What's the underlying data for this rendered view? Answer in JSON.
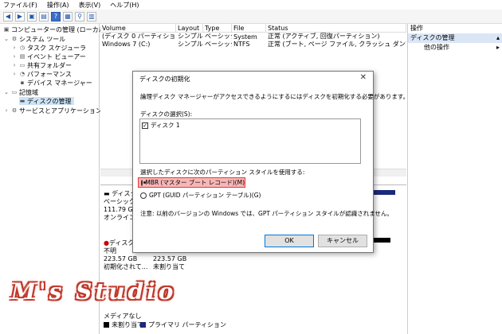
{
  "menu": [
    "ファイル(F)",
    "操作(A)",
    "表示(V)",
    "ヘルプ(H)"
  ],
  "tree": {
    "root": "コンピューターの管理 (ローカル)",
    "system_tools": "システム ツール",
    "task_scheduler": "タスク スケジューラ",
    "event_viewer": "イベント ビューアー",
    "shared_folders": "共有フォルダー",
    "performance": "パフォーマンス",
    "device_manager": "デバイス マネージャー",
    "storage": "記憶域",
    "disk_management": "ディスクの管理",
    "services_apps": "サービスとアプリケーション"
  },
  "volume_list": {
    "headers": [
      "Volume",
      "Layout",
      "Type",
      "File System",
      "Status"
    ],
    "rows": [
      [
        "(ディスク 0 パーティション 1)",
        "シンプル",
        "ベーシック",
        "",
        "正常 (アクティブ, 回復パーティション)"
      ],
      [
        "Windows 7 (C:)",
        "シンプル",
        "ベーシック",
        "NTFS",
        "正常 (ブート, ページ ファイル, クラッシュ ダンプ, プライマリ パ"
      ]
    ]
  },
  "disks": {
    "disk0": {
      "label": "ディスク",
      "type": "ベーシック",
      "size": "111.79 GB",
      "status": "オンライン"
    },
    "disk1": {
      "label": "ディスク",
      "type": "不明",
      "size": "223.57 GB",
      "status": "初期化されて...",
      "part_size": "223.57 GB",
      "part_status": "未割り当て"
    }
  },
  "legend": {
    "media": "メディアなし",
    "unallocated": "未割り当て",
    "primary": "プライマリ パーティション"
  },
  "actions": {
    "title": "操作",
    "section": "ディスクの管理",
    "other": "他の操作"
  },
  "dialog": {
    "title": "ディスクの初期化",
    "description": "論理ディスク マネージャーがアクセスできるようにするにはディスクを初期化する必要があります。",
    "select_label": "ディスクの選択(S):",
    "disk_item": "ディスク 1",
    "style_label": "選択したディスクに次のパーティション スタイルを使用する:",
    "mbr": "MBR (マスター ブート レコード)(M)",
    "gpt": "GPT (GUID パーティション テーブル)(G)",
    "note": "注意: 以前のバージョンの Windows では、GPT パーティション スタイルが認識されません。",
    "ok": "OK",
    "cancel": "キャンセル"
  },
  "watermark": "M's Studio",
  "colors": {
    "highlight_red": "#e33333",
    "selection_blue": "#cde4f7",
    "primary_partition": "#1b2a7a"
  }
}
